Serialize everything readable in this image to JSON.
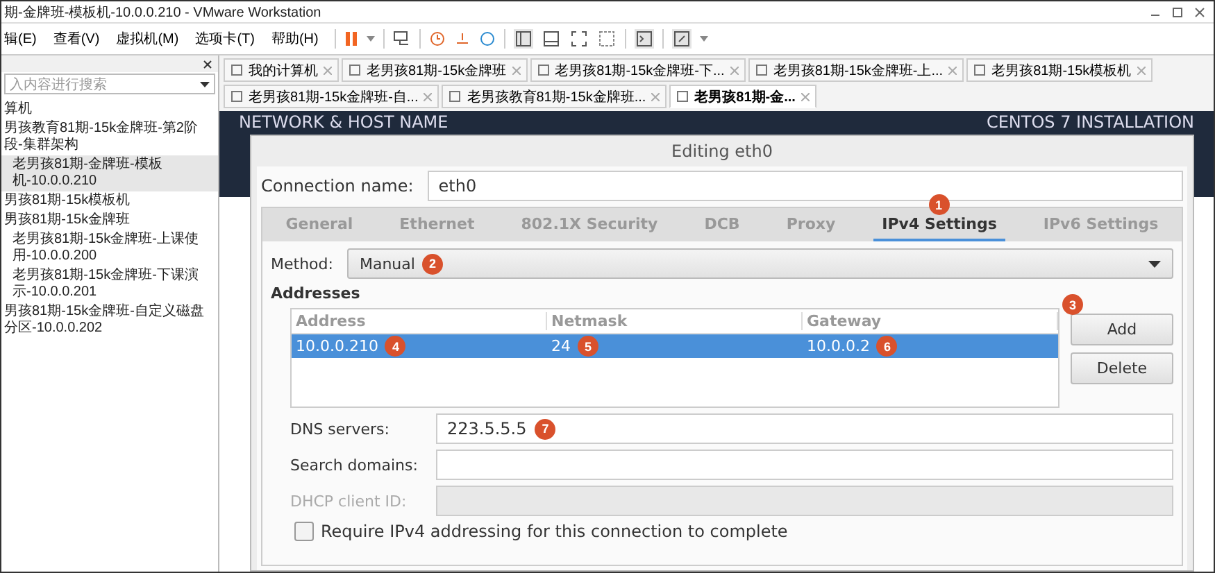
{
  "window": {
    "title": "期-金牌班-模板机-10.0.0.210 - VMware Workstation"
  },
  "menu": [
    "辑(E)",
    "查看(V)",
    "虚拟机(M)",
    "选项卡(T)",
    "帮助(H)"
  ],
  "library": {
    "search": {
      "placeholder": "入内容进行搜索"
    },
    "tree": [
      {
        "label": "算机",
        "selected": false
      },
      {
        "label": "男孩教育81期-15k金牌班-第2阶段-集群架构",
        "selected": false,
        "children": [
          {
            "label": "老男孩81期-金牌班-模板机-10.0.0.210",
            "selected": true
          }
        ]
      },
      {
        "label": "男孩81期-15k模板机",
        "selected": false
      },
      {
        "label": "男孩81期-15k金牌班",
        "selected": false,
        "children": [
          {
            "label": "老男孩81期-15k金牌班-上课使用-10.0.0.200",
            "selected": false
          },
          {
            "label": "老男孩81期-15k金牌班-下课演示-10.0.0.201",
            "selected": false
          }
        ]
      },
      {
        "label": "男孩81期-15k金牌班-自定义磁盘分区-10.0.0.202",
        "selected": false
      }
    ]
  },
  "vm_tabs": [
    {
      "label": "我的计算机",
      "selected": false
    },
    {
      "label": "老男孩81期-15k金牌班",
      "selected": false
    },
    {
      "label": "老男孩81期-15k金牌班-下...",
      "selected": false
    },
    {
      "label": "老男孩81期-15k金牌班-上...",
      "selected": false
    },
    {
      "label": "老男孩81期-15k模板机",
      "selected": false
    },
    {
      "label": "老男孩81期-15k金牌班-自...",
      "selected": false
    },
    {
      "label": "老男孩教育81期-15k金牌班...",
      "selected": false
    },
    {
      "label": "老男孩81期-金...",
      "selected": true
    }
  ],
  "installer": {
    "section_title": "NETWORK & HOST NAME",
    "product_title": "CENTOS 7 INSTALLATION"
  },
  "dialog": {
    "title": "Editing eth0",
    "connection_name": {
      "label": "Connection name:",
      "value": "eth0"
    },
    "tabs": [
      {
        "label": "General",
        "selected": false
      },
      {
        "label": "Ethernet",
        "selected": false
      },
      {
        "label": "802.1X Security",
        "selected": false
      },
      {
        "label": "DCB",
        "selected": false
      },
      {
        "label": "Proxy",
        "selected": false
      },
      {
        "label": "IPv4 Settings",
        "selected": true,
        "badge": "1"
      },
      {
        "label": "IPv6 Settings",
        "selected": false
      }
    ],
    "method": {
      "label": "Method:",
      "value": "Manual",
      "badge": "2"
    },
    "addresses": {
      "title": "Addresses",
      "columns": [
        "Address",
        "Netmask",
        "Gateway"
      ],
      "rows": [
        {
          "selected": true,
          "cells": [
            {
              "text": "10.0.0.210",
              "badge": "4"
            },
            {
              "text": "24",
              "badge": "5"
            },
            {
              "text": "10.0.0.2",
              "badge": "6"
            }
          ]
        }
      ],
      "buttons": [
        {
          "label": "Add",
          "badge": "3"
        },
        {
          "label": "Delete"
        }
      ]
    },
    "fields": [
      {
        "label": "DNS servers:",
        "value": "223.5.5.5",
        "badge": "7",
        "disabled": false
      },
      {
        "label": "Search domains:",
        "disabled": false
      },
      {
        "label": "DHCP client ID:",
        "disabled": true
      }
    ],
    "require_checkbox": {
      "label": "Require IPv4 addressing for this connection to complete",
      "checked": false
    }
  }
}
